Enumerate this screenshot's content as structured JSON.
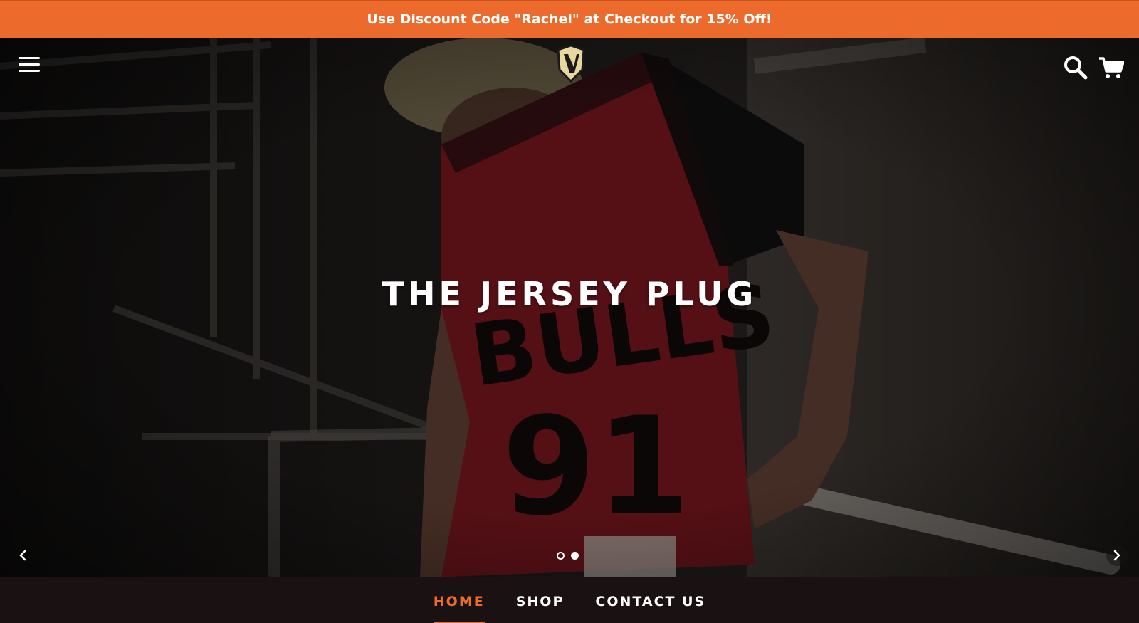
{
  "announcement": {
    "text": "Use Discount Code \"Rachel\" at Checkout for 15% Off!"
  },
  "header": {
    "menu_icon": "hamburger-menu-icon",
    "logo_icon": "shield-logo-icon",
    "search_icon": "search-icon",
    "cart_icon": "cart-icon"
  },
  "hero": {
    "title": "THE JERSEY PLUG",
    "slide_count": 2,
    "active_slide": 1,
    "prev_icon": "chevron-left-icon",
    "next_icon": "chevron-right-icon"
  },
  "nav": {
    "items": [
      {
        "label": "HOME",
        "active": true
      },
      {
        "label": "SHOP",
        "active": false
      },
      {
        "label": "CONTACT US",
        "active": false
      }
    ]
  },
  "colors": {
    "accent": "#ec6a2c",
    "nav_bg": "#1a1212",
    "text": "#ffffff"
  }
}
